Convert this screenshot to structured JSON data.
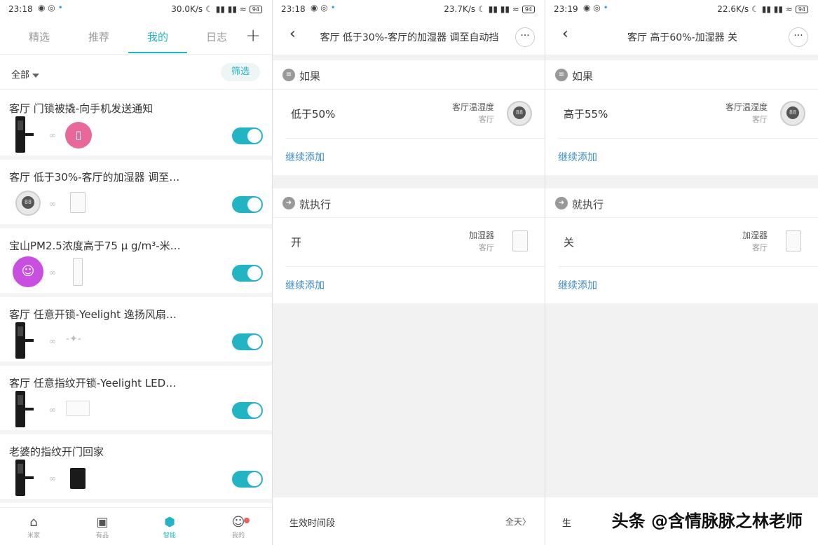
{
  "screen1": {
    "status": {
      "time": "23:18",
      "speed": "30.0K/s",
      "battery": "94"
    },
    "tabs": [
      "精选",
      "推荐",
      "我的",
      "日志"
    ],
    "add_icon": "plus-icon",
    "filter": {
      "all_label": "全部",
      "filter_button": "筛选"
    },
    "scenes": [
      {
        "title": "客厅 门锁被撬-向手机发送通知",
        "enabled": true
      },
      {
        "title": "客厅 低于30%-客厅的加湿器 调至…",
        "enabled": true
      },
      {
        "title": "宝山PM2.5浓度高于75 μ g/m³-米…",
        "enabled": true
      },
      {
        "title": "客厅 任意开锁-Yeelight 逸扬风扇…",
        "enabled": true
      },
      {
        "title": "客厅 任意指纹开锁-Yeelight LED…",
        "enabled": true
      },
      {
        "title": "老婆的指纹开门回家",
        "enabled": true
      }
    ],
    "nav": [
      {
        "label": "米家",
        "icon": "home-icon"
      },
      {
        "label": "有品",
        "icon": "shop-icon"
      },
      {
        "label": "智能",
        "icon": "smart-icon"
      },
      {
        "label": "我的",
        "icon": "profile-icon"
      }
    ]
  },
  "screen2": {
    "status": {
      "time": "23:18",
      "speed": "23.7K/s",
      "battery": "94"
    },
    "title": "客厅 低于30%-客厅的加湿器 调至自动挡",
    "if_label": "如果",
    "condition": {
      "text": "低于50%",
      "device": "客厅温湿度",
      "room": "客厅"
    },
    "add_more": "继续添加",
    "then_label": "就执行",
    "action": {
      "text": "开",
      "device": "加湿器",
      "room": "客厅"
    },
    "footer": {
      "label": "生效时间段",
      "value": "全天"
    }
  },
  "screen3": {
    "status": {
      "time": "23:19",
      "speed": "22.6K/s",
      "battery": "94"
    },
    "title": "客厅 高于60%-加湿器 关",
    "if_label": "如果",
    "condition": {
      "text": "高于55%",
      "device": "客厅温湿度",
      "room": "客厅"
    },
    "add_more": "继续添加",
    "then_label": "就执行",
    "action": {
      "text": "关",
      "device": "加湿器",
      "room": "客厅"
    },
    "footer": {
      "label": "生"
    }
  },
  "watermark": "头条 @含情脉脉之林老师",
  "colors": {
    "accent": "#21b4c4",
    "link": "#3a8cc7"
  }
}
